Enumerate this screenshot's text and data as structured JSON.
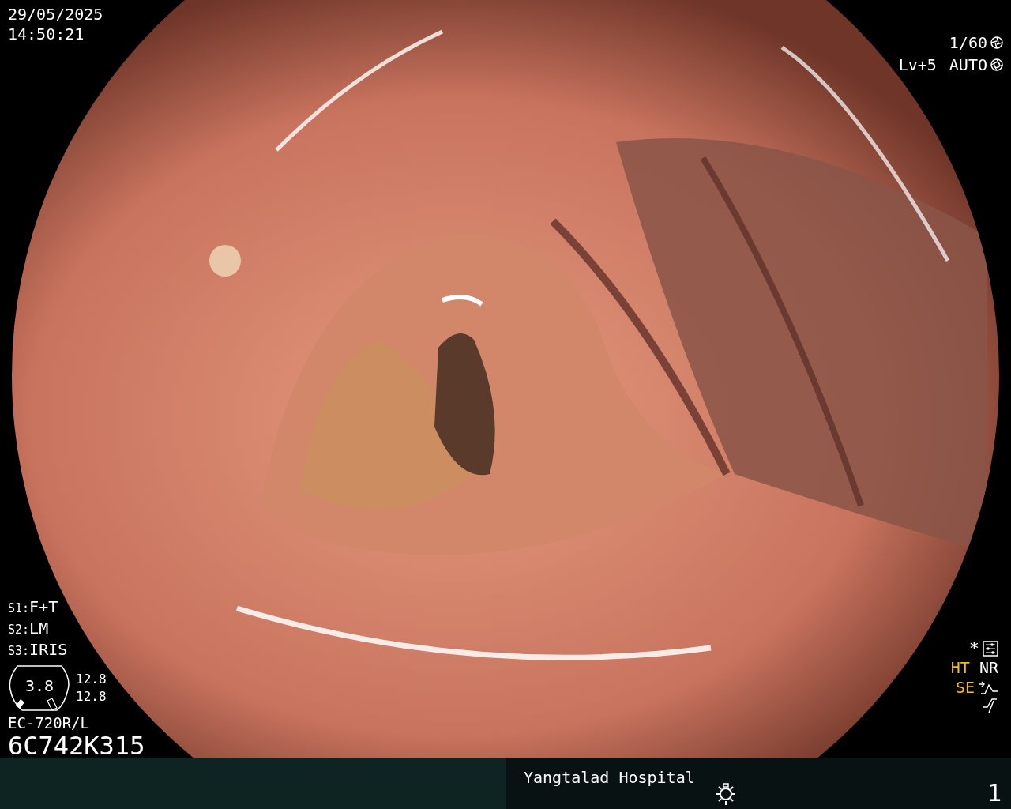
{
  "header": {
    "date": "29/05/2025",
    "time": "14:50:21"
  },
  "exposure": {
    "shutter": "1/60",
    "level": "Lv+5",
    "iris": "AUTO"
  },
  "switches": [
    {
      "label": "S1:",
      "value": "F+T"
    },
    {
      "label": "S2:",
      "value": "LM"
    },
    {
      "label": "S3:",
      "value": "IRIS"
    }
  ],
  "scope_gauge": {
    "value": "3.8",
    "readings": [
      "12.8",
      "12.8"
    ]
  },
  "scope_model": "EC-720R/L",
  "serial": "6C742K315",
  "preset_mark": "*",
  "modes": [
    {
      "label": "HT",
      "on": true
    },
    {
      "label": "NR",
      "on": false
    }
  ],
  "enhancement": {
    "label": "SE",
    "on": true
  },
  "footer": {
    "hospital": "Yangtalad Hospital",
    "page": "1"
  }
}
